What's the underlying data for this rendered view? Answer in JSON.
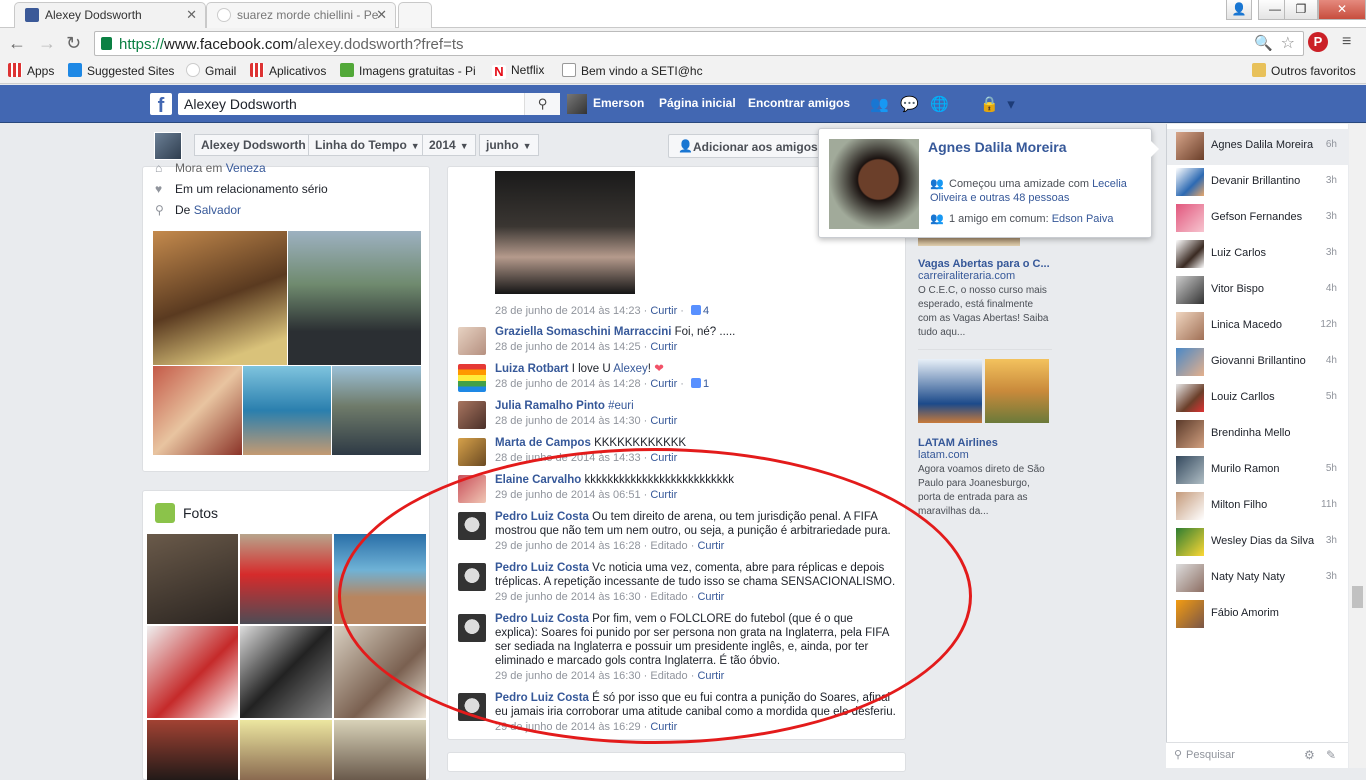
{
  "browser": {
    "tabs": [
      {
        "title": "Alexey Dodsworth",
        "active": true
      },
      {
        "title": "suarez morde chiellini - Pe",
        "active": false
      }
    ],
    "url_scheme": "https://",
    "url_host": "www.facebook.com",
    "url_path": "/alexey.dodsworth?fref=ts",
    "bookmarks": [
      "Apps",
      "Suggested Sites",
      "Gmail",
      "Aplicativos",
      "Imagens gratuitas - Pi",
      "Netflix",
      "Bem vindo a SETI@hc"
    ],
    "other_bookmarks": "Outros favoritos"
  },
  "fb": {
    "search_value": "Alexey Dodsworth",
    "user_name": "Emerson",
    "nav_home": "Página inicial",
    "nav_find_friends": "Encontrar amigos",
    "brand_color": "#4267b2"
  },
  "timeline": {
    "profile_name": "Alexey Dodsworth",
    "crumb_timeline": "Linha do Tempo",
    "crumb_year": "2014",
    "crumb_month": "junho",
    "add_friend": "Adicionar aos amigos"
  },
  "intro": {
    "lives_prefix": "Mora em ",
    "lives_city": "Veneza",
    "relationship": "Em um relacionamento sério",
    "from_prefix": "De ",
    "from_city": "Salvador"
  },
  "photos": {
    "title": "Fotos"
  },
  "post": {
    "meta_date": "28 de junho de 2014 às 14:23",
    "like_label": "Curtir",
    "like_count": "4"
  },
  "comments": [
    {
      "name": "Graziella Somaschini Marraccini",
      "text": "Foi, né? .....",
      "date": "28 de junho de 2014 às 14:25",
      "edited": "",
      "likes": ""
    },
    {
      "name": "Luiza Rotbart",
      "text": "I love U ",
      "mention": "Alexey",
      "emoji": "!",
      "date": "28 de junho de 2014 às 14:28",
      "edited": "",
      "likes": "1"
    },
    {
      "name": "Julia Ramalho Pinto",
      "text": "",
      "tag": "#euri",
      "date": "28 de junho de 2014 às 14:30",
      "edited": "",
      "likes": ""
    },
    {
      "name": "Marta de Campos",
      "text": "KKKKKKKKKKKK",
      "date": "28 de junho de 2014 às 14:33",
      "edited": "",
      "likes": ""
    },
    {
      "name": "Elaine Carvalho",
      "text": "kkkkkkkkkkkkkkkkkkkkkkkkkk",
      "date": "29 de junho de 2014 às 06:51",
      "edited": "",
      "likes": ""
    },
    {
      "name": "Pedro Luiz Costa",
      "text": "Ou tem direito de arena, ou tem jurisdição penal. A FIFA mostrou que não tem um nem outro, ou seja, a punição é arbitrariedade pura.",
      "date": "29 de junho de 2014 às 16:28",
      "edited": "Editado",
      "likes": ""
    },
    {
      "name": "Pedro Luiz Costa",
      "text": "Vc noticia uma vez, comenta, abre para réplicas e depois tréplicas. A repetição incessante de tudo isso se chama SENSACIONALISMO.",
      "date": "29 de junho de 2014 às 16:30",
      "edited": "Editado",
      "likes": ""
    },
    {
      "name": "Pedro Luiz Costa",
      "text": "Por fim, vem o FOLCLORE do futebol (que é o que explica): Soares foi punido por ser persona non grata na Inglaterra, pela FIFA ser sediada na Inglaterra e possuir um presidente inglês, e, ainda, por ter eliminado e marcado gols contra Inglaterra. É tão óbvio.",
      "date": "29 de junho de 2014 às 16:30",
      "edited": "Editado",
      "likes": ""
    },
    {
      "name": "Pedro Luiz Costa",
      "text": "É só por isso que eu fui contra a punição do Soares, afinal eu jamais iria corroborar uma atitude canibal como a mordida que ele desferiu.",
      "date": "29 de junho de 2014 às 16:29",
      "edited": "",
      "likes": ""
    }
  ],
  "ads": [
    {
      "title": "Vagas Abertas para o C...",
      "site": "carreiraliteraria.com",
      "text": "O C.E.C, o nosso curso mais esperado, está finalmente com as Vagas Abertas! Saiba tudo aqu..."
    },
    {
      "title": "LATAM Airlines",
      "site": "latam.com",
      "text": "Agora voamos direto de São Paulo para Joanesburgo, porta de entrada para as maravilhas da..."
    }
  ],
  "hovercard": {
    "name": "Agnes Dalila Moreira",
    "friendship_prefix": "Começou uma amizade com ",
    "friendship_names": "Lecelia Oliveira e outras 48 pessoas",
    "mutual_prefix": "1 amigo em comum: ",
    "mutual_name": "Edson Paiva"
  },
  "chat": {
    "contacts": [
      {
        "name": "Agnes Dalila Moreira",
        "time": "6h"
      },
      {
        "name": "Devanir Brillantino",
        "time": "3h"
      },
      {
        "name": "Gefson Fernandes",
        "time": "3h"
      },
      {
        "name": "Luiz Carlos",
        "time": "3h"
      },
      {
        "name": "Vitor Bispo",
        "time": "4h"
      },
      {
        "name": "Linica Macedo",
        "time": "12h"
      },
      {
        "name": "Giovanni Brillantino",
        "time": "4h"
      },
      {
        "name": "Louiz Carllos",
        "time": "5h"
      },
      {
        "name": "Brendinha Mello",
        "time": ""
      },
      {
        "name": "Murilo Ramon",
        "time": "5h"
      },
      {
        "name": "Milton Filho",
        "time": "11h"
      },
      {
        "name": "Wesley Dias da Silva",
        "time": "3h"
      },
      {
        "name": "Naty Naty Naty",
        "time": "3h"
      },
      {
        "name": "Fábio Amorim",
        "time": ""
      }
    ],
    "search_placeholder": "Pesquisar"
  }
}
